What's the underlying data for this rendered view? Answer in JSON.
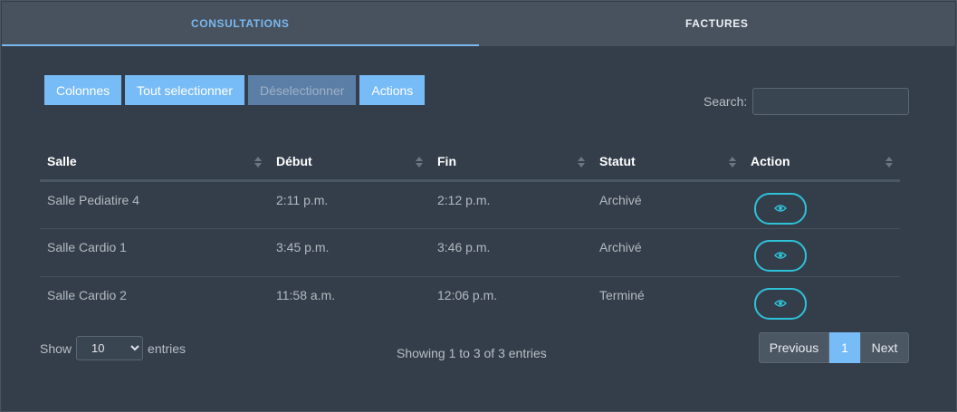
{
  "tabs": [
    {
      "label": "CONSULTATIONS",
      "active": true
    },
    {
      "label": "FACTURES",
      "active": false
    }
  ],
  "toolbar": {
    "columns": "Colonnes",
    "select_all": "Tout selectionner",
    "deselect": "Déselectionner",
    "actions": "Actions"
  },
  "search": {
    "label": "Search:",
    "value": ""
  },
  "table": {
    "headers": [
      "Salle",
      "Début",
      "Fin",
      "Statut",
      "Action"
    ],
    "rows": [
      {
        "salle": "Salle Pediatire 4",
        "debut": "2:11 p.m.",
        "fin": "2:12 p.m.",
        "statut": "Archivé"
      },
      {
        "salle": "Salle Cardio 1",
        "debut": "3:45 p.m.",
        "fin": "3:46 p.m.",
        "statut": "Archivé"
      },
      {
        "salle": "Salle Cardio 2",
        "debut": "11:58 a.m.",
        "fin": "12:06 p.m.",
        "statut": "Terminé"
      }
    ]
  },
  "length": {
    "prefix": "Show",
    "value": "10",
    "suffix": "entries"
  },
  "info": "Showing 1 to 3 of 3 entries",
  "pagination": {
    "previous": "Previous",
    "current": "1",
    "next": "Next"
  },
  "colors": {
    "accent": "#78bcf7",
    "eye": "#2fc1d8",
    "background": "#343e4a"
  },
  "icons": {
    "view": "eye-icon",
    "select_caret": "chevron-down-icon"
  }
}
